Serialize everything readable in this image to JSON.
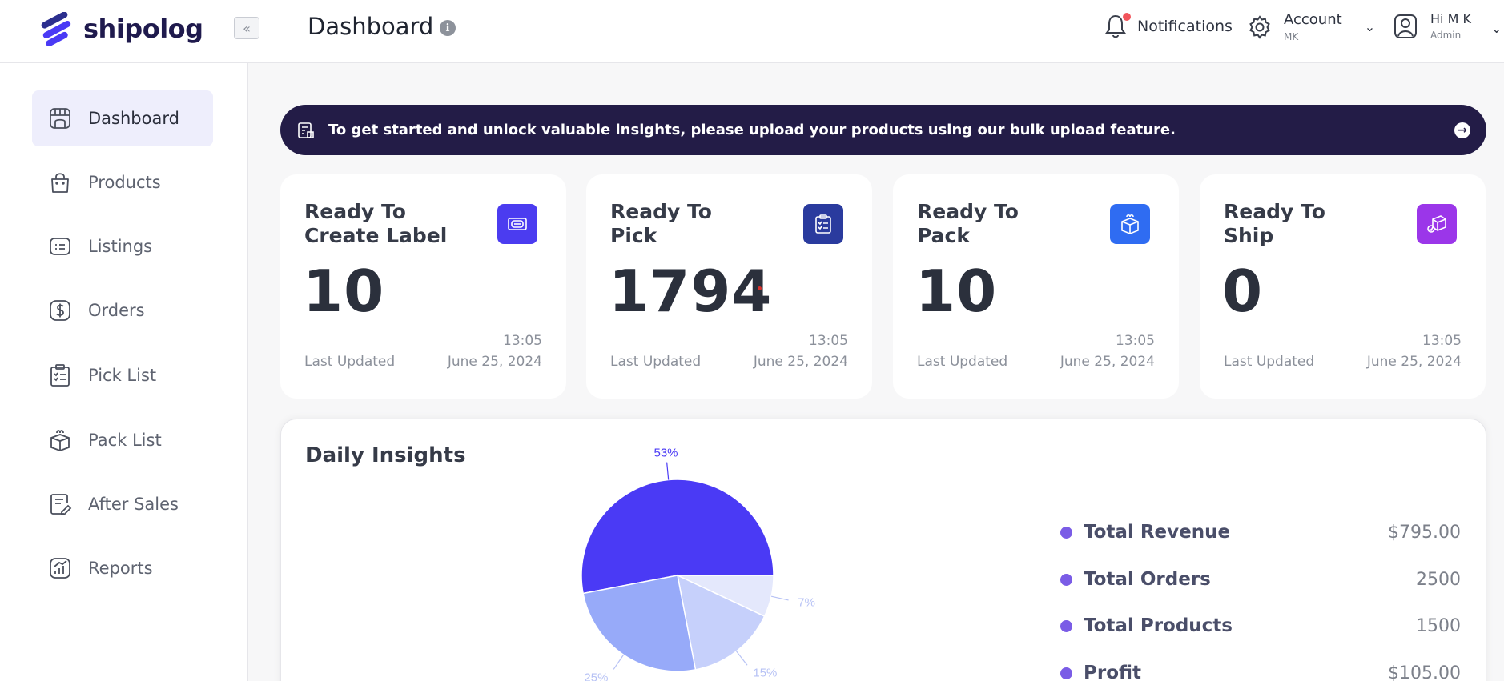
{
  "app": {
    "brand": "shipolog",
    "page_title": "Dashboard"
  },
  "header": {
    "notifications_label": "Notifications",
    "account": {
      "label": "Account",
      "sub": "MK"
    },
    "user": {
      "greeting": "Hi M K",
      "role": "Admin"
    }
  },
  "sidebar": {
    "items": [
      {
        "label": "Dashboard",
        "icon": "dashboard-icon",
        "active": true
      },
      {
        "label": "Products",
        "icon": "shopping-bag-icon"
      },
      {
        "label": "Listings",
        "icon": "listings-icon"
      },
      {
        "label": "Orders",
        "icon": "dollar-icon"
      },
      {
        "label": "Pick List",
        "icon": "clipboard-list-icon"
      },
      {
        "label": "Pack List",
        "icon": "package-icon"
      },
      {
        "label": "After Sales",
        "icon": "after-sales-icon"
      },
      {
        "label": "Reports",
        "icon": "chart-icon"
      }
    ]
  },
  "banner": {
    "text": "To get started and unlock valuable insights, please upload your products using our bulk upload feature."
  },
  "cards": [
    {
      "title_line1": "Ready To",
      "title_line2": "Create Label",
      "value": "10",
      "time": "13:05",
      "last_updated": "Last Updated",
      "date": "June 25, 2024",
      "icon": "label-icon",
      "color": "#4b3cf0"
    },
    {
      "title_line1": "Ready To",
      "title_line2": "Pick",
      "value": "1794",
      "time": "13:05",
      "last_updated": "Last Updated",
      "date": "June 25, 2024",
      "icon": "clipboard-icon",
      "color": "#2a3b9e"
    },
    {
      "title_line1": "Ready To",
      "title_line2": "Pack",
      "value": "10",
      "time": "13:05",
      "last_updated": "Last Updated",
      "date": "June 25, 2024",
      "icon": "box-icon",
      "color": "#2f6cf2"
    },
    {
      "title_line1": "Ready To",
      "title_line2": "Ship",
      "value": "0",
      "time": "13:05",
      "last_updated": "Last Updated",
      "date": "June 25, 2024",
      "icon": "shipping-icon",
      "color": "#9b36e9"
    }
  ],
  "insights": {
    "title": "Daily Insights",
    "metrics": [
      {
        "label": "Total Revenue",
        "value": "$795.00"
      },
      {
        "label": "Total Orders",
        "value": "2500"
      },
      {
        "label": "Total Products",
        "value": "1500"
      },
      {
        "label": "Profit",
        "value": "$105.00"
      }
    ]
  },
  "chart_data": {
    "type": "pie",
    "slices": [
      {
        "label": "53%",
        "value": 53,
        "color": "#4a3af5"
      },
      {
        "label": "7%",
        "value": 7,
        "color": "#e4e8fc"
      },
      {
        "label": "15%",
        "value": 15,
        "color": "#c6d0fb"
      },
      {
        "label": "25%",
        "value": 25,
        "color": "#97aaf9"
      }
    ]
  }
}
